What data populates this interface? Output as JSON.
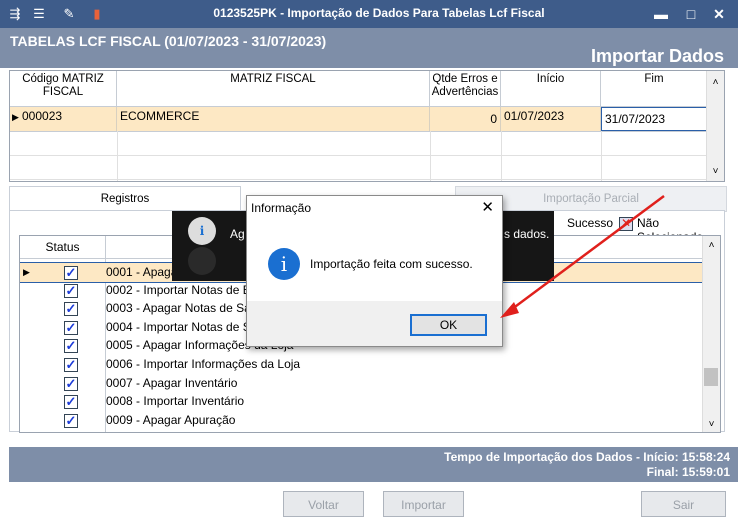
{
  "window": {
    "title": "0123525PK - Importação de Dados Para Tabelas Lcf Fiscal",
    "controls": {
      "minimize": "▬",
      "maximize": "□",
      "close": "✕"
    }
  },
  "header": {
    "subtitle": "TABELAS LCF FISCAL (01/07/2023 - 31/07/2023)",
    "title": "Importar Dados"
  },
  "top_grid": {
    "columns": [
      "Código MATRIZ FISCAL",
      "MATRIZ FISCAL",
      "Qtde Erros e Advertências",
      "Início",
      "Fim"
    ],
    "row": {
      "codigo": "000023",
      "matriz": "ECOMMERCE",
      "qtde": "0",
      "inicio": "01/07/2023",
      "fim": "31/07/2023"
    }
  },
  "tabs": {
    "registros": "Registros",
    "importacao_parcial": "Importação Parcial"
  },
  "legend": {
    "sucesso": "Sucesso",
    "nao_selecionado": "Não Selecionado"
  },
  "lower_grid": {
    "status_header": "Status",
    "rows": [
      "0001 - Apagar Notas de Entrada",
      "0002 - Importar Notas de Entrada",
      "0003 - Apagar Notas de Saída",
      "0004 - Importar Notas de Saída",
      "0005 - Apagar Informações da Loja",
      "0006 - Importar Informações da Loja",
      "0007 - Apagar Inventário",
      "0008 - Importar Inventário",
      "0009 - Apagar Apuração"
    ]
  },
  "background_msg": {
    "prefix": "Ag",
    "suffix": "s dados."
  },
  "dialog": {
    "title": "Informação",
    "message": "Importação feita com sucesso.",
    "ok": "OK",
    "close": "✕"
  },
  "footer": {
    "line1": "Tempo de Importação dos Dados - Início: 15:58:24",
    "line2": "Final: 15:59:01"
  },
  "buttons": {
    "voltar": "Voltar",
    "importar": "Importar",
    "sair": "Sair"
  },
  "colors": {
    "titlebar": "#3e5c8a",
    "header": "#7e8ea8",
    "row_highlight": "#fde8c4",
    "arrow": "#e0201c",
    "info_icon": "#1a6fd1"
  }
}
